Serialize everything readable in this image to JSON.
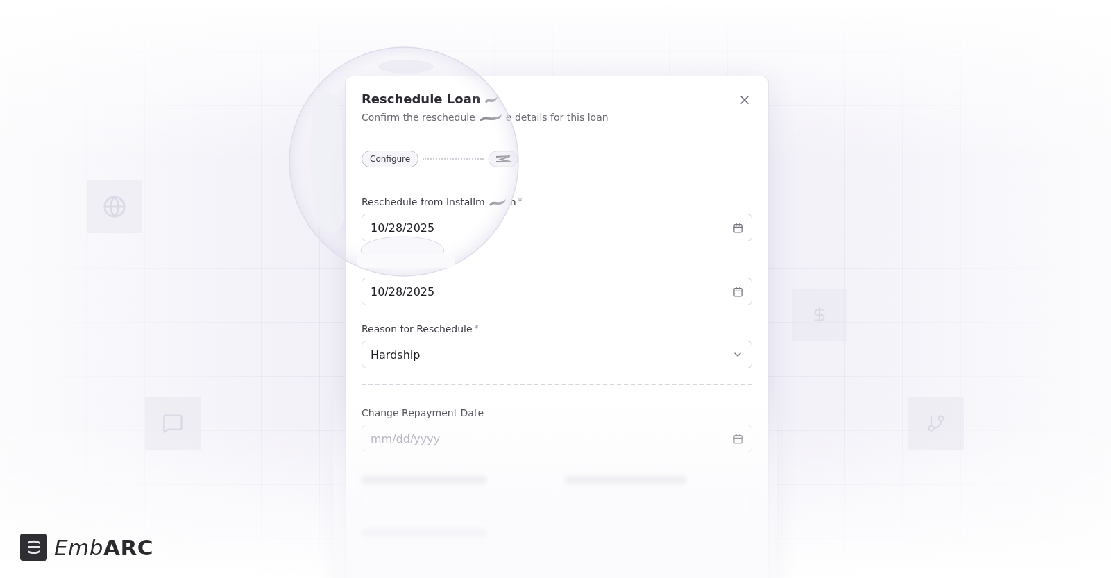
{
  "dialog": {
    "title": "Reschedule Loan",
    "subtitle_parts": [
      "Confirm the reschedule",
      "e details for this loan"
    ],
    "steps": [
      {
        "label": "Configure",
        "selected": true
      }
    ],
    "fields": [
      {
        "kind": "date",
        "label_parts": [
          "Reschedule from Installm",
          "n"
        ],
        "required": true,
        "required_mark": "*",
        "value": "10/28/2025"
      },
      {
        "kind": "date",
        "value": "10/28/2025"
      },
      {
        "kind": "select",
        "label_parts": [
          "Reason for Reschedule"
        ],
        "required": true,
        "required_mark": "*",
        "value": "Hardship"
      },
      {
        "kind": "divider"
      },
      {
        "kind": "date",
        "label_parts": [
          "Change Repayment Date"
        ],
        "placeholder": "mm/dd/yyyy"
      }
    ]
  },
  "brand": {
    "parts": [
      "Emb",
      "ARC"
    ]
  }
}
